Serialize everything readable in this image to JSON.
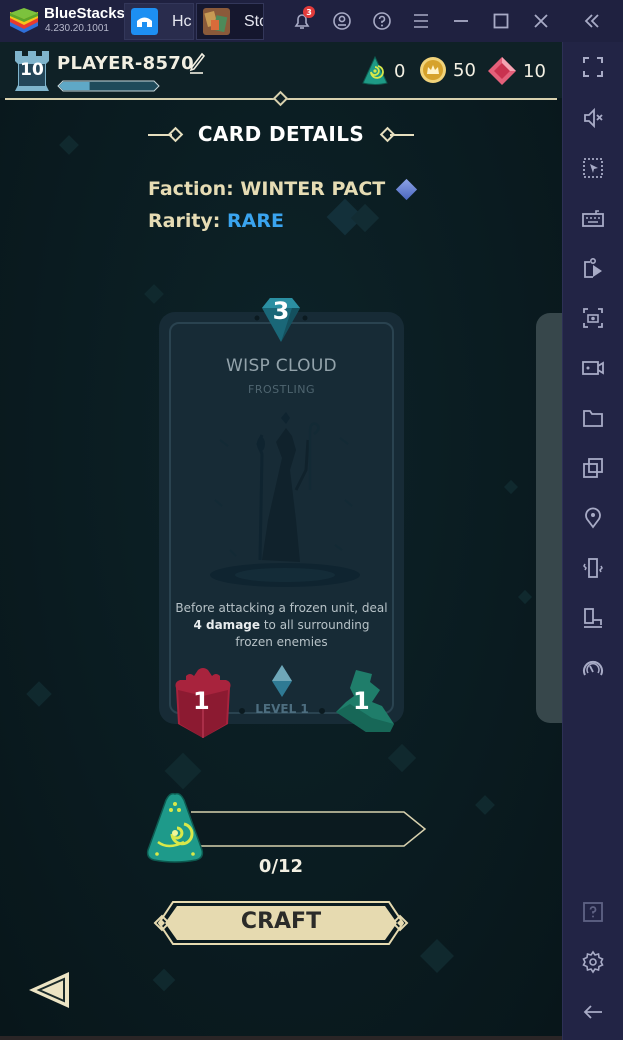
{
  "titlebar": {
    "app_name": "BlueStacks",
    "version": "4.230.20.1001",
    "tabs": [
      {
        "label": "Home",
        "display": "Hc",
        "icon": "home-icon",
        "active": false
      },
      {
        "label": "Storm",
        "display": "Stc",
        "icon": "game-thumbnail-icon",
        "active": true
      }
    ],
    "notification_count": "3",
    "buttons": [
      "notifications",
      "account",
      "help",
      "menu",
      "minimize",
      "maximize",
      "close",
      "collapse-sidebar"
    ]
  },
  "sidebar": {
    "items": [
      {
        "name": "fullscreen",
        "icon": "fullscreen-icon"
      },
      {
        "name": "volume-mute",
        "icon": "volume-mute-icon"
      },
      {
        "name": "pointer-lock",
        "icon": "pointer-select-icon"
      },
      {
        "name": "keyboard-controls",
        "icon": "keyboard-icon"
      },
      {
        "name": "install-apk",
        "icon": "install-apk-icon"
      },
      {
        "name": "screenshot",
        "icon": "screenshot-icon"
      },
      {
        "name": "record",
        "icon": "video-record-icon"
      },
      {
        "name": "media-folder",
        "icon": "folder-icon"
      },
      {
        "name": "multi-instance",
        "icon": "multi-instance-icon"
      },
      {
        "name": "location",
        "icon": "location-pin-icon"
      },
      {
        "name": "shake",
        "icon": "shake-icon"
      },
      {
        "name": "rotate",
        "icon": "rotate-icon"
      },
      {
        "name": "eco-mode",
        "icon": "speedometer-icon"
      },
      {
        "name": "help",
        "icon": "help-icon"
      },
      {
        "name": "settings",
        "icon": "gear-icon"
      },
      {
        "name": "back",
        "icon": "back-arrow-icon"
      }
    ]
  },
  "game": {
    "player": {
      "level": "10",
      "name": "PLAYER-8570",
      "xp_progress": 0.28
    },
    "currencies": [
      {
        "name": "shards",
        "icon": "shard-icon",
        "value": "0"
      },
      {
        "name": "coins",
        "icon": "coin-icon",
        "value": "50"
      },
      {
        "name": "rubies",
        "icon": "ruby-icon",
        "value": "10"
      }
    ],
    "section_title": "CARD DETAILS",
    "faction_label": "Faction:",
    "faction_value": "WINTER PACT",
    "rarity_label": "Rarity:",
    "rarity_value": "RARE",
    "card": {
      "cost": "3",
      "name": "WISP CLOUD",
      "type": "FROSTLING",
      "desc_pre": "Before attacking a frozen unit, deal ",
      "desc_bold": "4 damage",
      "desc_post": " to all surrounding frozen enemies",
      "attack": "1",
      "movement": "1",
      "level": "LEVEL 1"
    },
    "craft_progress": {
      "text": "0/12",
      "current": 0,
      "required": 12
    },
    "craft_label": "CRAFT"
  },
  "colors": {
    "accent_gold": "#d8d1ae",
    "rarity_rare": "#3aa4ef",
    "attack_red": "#a8233d",
    "movement_green": "#1f7d6a",
    "bluestacks_bg": "#1f2140"
  }
}
